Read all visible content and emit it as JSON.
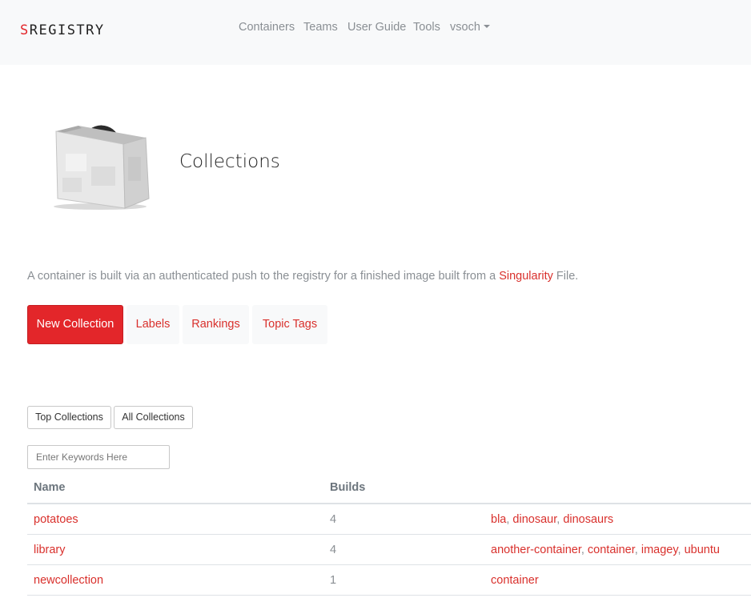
{
  "brand": {
    "first_letter": "S",
    "rest": "REGISTRY"
  },
  "nav": {
    "items": [
      "Containers",
      "Teams",
      "User Guide",
      "Tools"
    ],
    "user": "vsoch"
  },
  "page": {
    "title": "Collections",
    "intro_before": "A container is built via an authenticated push to the registry for a finished image built from a ",
    "intro_link": "Singularity",
    "intro_after": " File."
  },
  "tabs": [
    "New Collection",
    "Labels",
    "Rankings",
    "Topic Tags"
  ],
  "filters": {
    "top": "Top Collections",
    "all": "All Collections"
  },
  "search": {
    "placeholder": "Enter Keywords Here",
    "value": ""
  },
  "table": {
    "headers": [
      "Name",
      "Builds",
      ""
    ],
    "rows": [
      {
        "name": "potatoes",
        "builds": "4",
        "tags": [
          "bla",
          "dinosaur",
          "dinosaurs"
        ]
      },
      {
        "name": "library",
        "builds": "4",
        "tags": [
          "another-container",
          "container",
          "imagey",
          "ubuntu"
        ]
      },
      {
        "name": "newcollection",
        "builds": "1",
        "tags": [
          "container"
        ]
      }
    ]
  },
  "colors": {
    "accent": "#e3262a",
    "link": "#d9302c",
    "muted": "#8a8f94",
    "navbar": "#f8f9fa"
  }
}
